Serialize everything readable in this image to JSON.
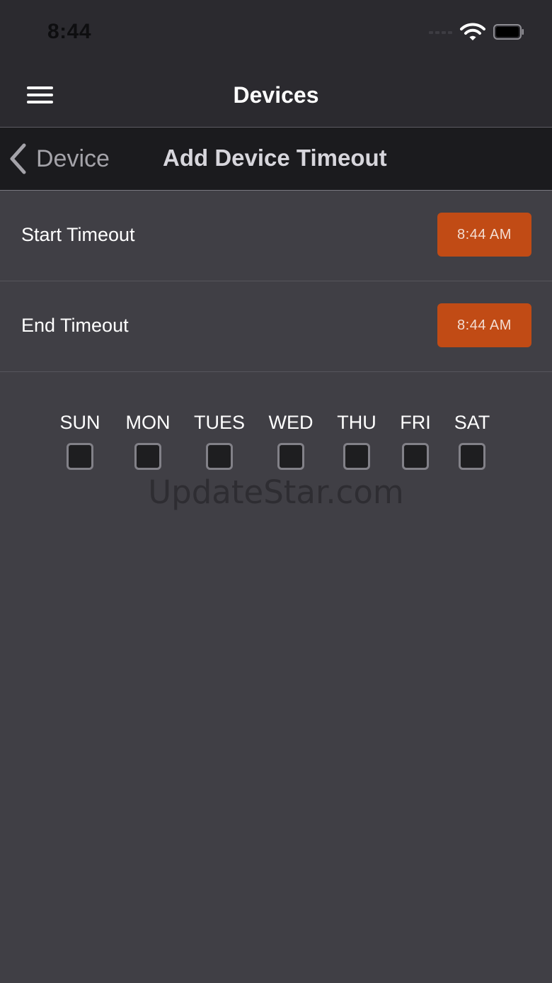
{
  "status_bar": {
    "time": "8:44",
    "icons": [
      "cellular-signal-icon",
      "wifi-icon",
      "battery-icon"
    ]
  },
  "header": {
    "menu_icon": "hamburger-menu-icon",
    "title": "Devices"
  },
  "subheader": {
    "back_icon": "chevron-left-icon",
    "back_label": "Device",
    "title": "Add Device Timeout"
  },
  "settings": {
    "start": {
      "label": "Start Timeout",
      "value": "8:44 AM"
    },
    "end": {
      "label": "End Timeout",
      "value": "8:44 AM"
    }
  },
  "days": [
    {
      "label": "SUN",
      "checked": false
    },
    {
      "label": "MON",
      "checked": false
    },
    {
      "label": "TUES",
      "checked": false
    },
    {
      "label": "WED",
      "checked": false
    },
    {
      "label": "THU",
      "checked": false
    },
    {
      "label": "FRI",
      "checked": false
    },
    {
      "label": "SAT",
      "checked": false
    }
  ],
  "watermark": "UpdateStar.com",
  "colors": {
    "accent": "#c14b15",
    "background": "#403f45",
    "nav_background": "#2b2a2f",
    "subnav_background": "#1b1b1e"
  }
}
